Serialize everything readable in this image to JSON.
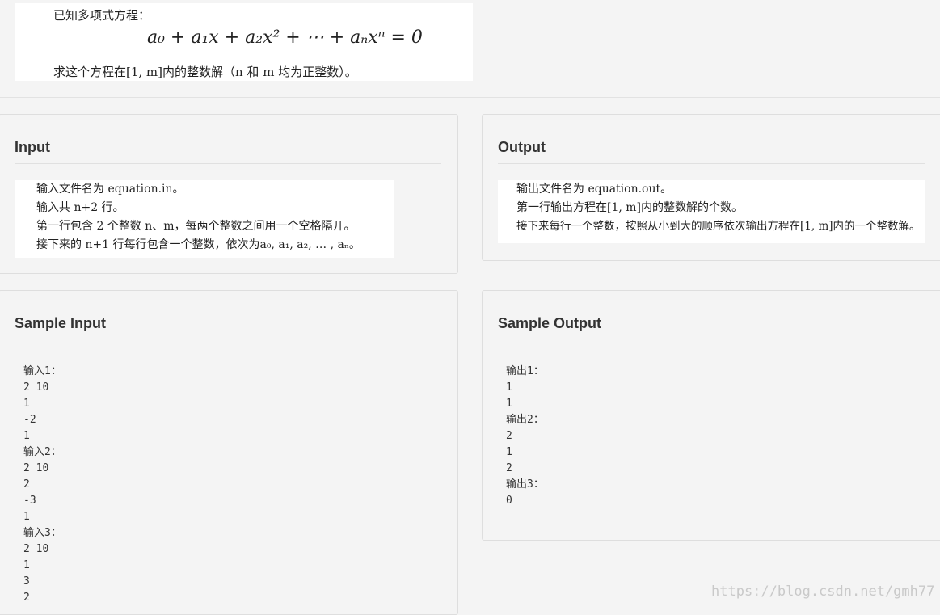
{
  "problem": {
    "intro": "已知多项式方程：",
    "equation": "a₀ + a₁x + a₂x² + ⋯ + aₙxⁿ = 0",
    "question": "求这个方程在[1, m]内的整数解（n 和 m 均为正整数）。"
  },
  "input": {
    "title": "Input",
    "lines": [
      "输入文件名为 equation.in。",
      "输入共 n+2 行。",
      "第一行包含 2 个整数 n、m，每两个整数之间用一个空格隔开。",
      "接下来的 n+1 行每行包含一个整数，依次为a₀, a₁, a₂, … , aₙ。"
    ]
  },
  "output": {
    "title": "Output",
    "lines": [
      "输出文件名为 equation.out。",
      "第一行输出方程在[1, m]内的整数解的个数。",
      "接下来每行一个整数，按照从小到大的顺序依次输出方程在[1, m]内的一个整数解。"
    ]
  },
  "sample_input": {
    "title": "Sample Input",
    "text": "输入1：\n2 10\n1\n-2\n1\n输入2：\n2 10\n2\n-3\n1\n输入3：\n2 10\n1\n3\n2"
  },
  "sample_output": {
    "title": "Sample Output",
    "text": "输出1：\n1\n1\n输出2：\n2\n1\n2\n输出3：\n0"
  },
  "watermark": "https://blog.csdn.net/gmh77"
}
